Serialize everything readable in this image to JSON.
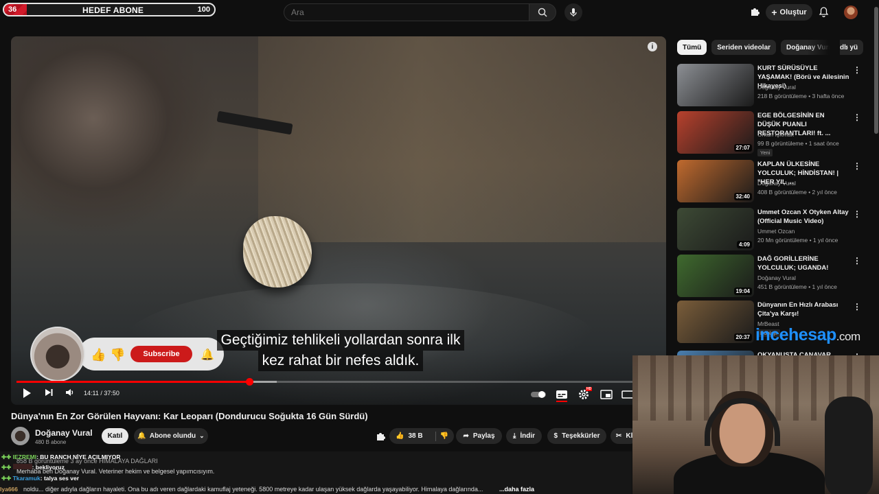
{
  "goal": {
    "current": "36",
    "label": "HEDEF ABONE",
    "target": "100",
    "progress_fraction": 0.36
  },
  "search": {
    "placeholder": "Ara"
  },
  "header": {
    "create_label": "Oluştur",
    "create_icon": "plus-icon",
    "notifications_icon": "bell-icon"
  },
  "player": {
    "captions": [
      "Geçtiğimiz tehlikeli yollardan sonra ilk",
      "kez rahat bir nefes aldık."
    ],
    "time": "14:11 / 37:50",
    "played_fraction": 0.376,
    "buffered_fraction": 0.42,
    "info_label": "i",
    "subscribe_widget_label": "Subscribe",
    "settings_badge": "HD"
  },
  "video": {
    "title": "Dünya'nın En Zor Görülen Hayvanı: Kar Leoparı (Dondurucu Soğukta 16 Gün Sürdü)",
    "channel": "Doğanay Vural",
    "subscribers": "480 B abone",
    "join_label": "Katıl",
    "subscribed_label": "Abone olundu",
    "likes": "38 B",
    "share_label": "Paylaş",
    "download_label": "İndir",
    "thanks_label": "Teşekkürler",
    "clip_label": "Kl"
  },
  "description": {
    "views_line": "858 B görüntüleme  3 ay önce  HİMALAYA DAĞLARI",
    "line1": "Merhaba ben Doğanay Vural. Veteriner hekim ve belgesel yapımcısıyım.",
    "line2": "noldu... diğer adıyla dağların hayaleti. Ona bu adı veren dağlardaki kamuflaj yeteneği. 5800 metreye kadar ulaşan yüksek dağlarda yaşayabiliyor. Himalaya dağlarında...",
    "more_label": "...daha fazla"
  },
  "chat": [
    {
      "user": "IEZREMI",
      "text": ": BU RANCH NİYE AÇILMIYOR",
      "color": "#7bd35a"
    },
    {
      "user": "",
      "text": ": bekliyoruz",
      "color": "#c04646"
    },
    {
      "user": "Tkaramuk",
      "text": ": talya ses ver",
      "color": "#3aa0e0"
    },
    {
      "user": "lya666",
      "text": "",
      "color": "#c9a060"
    }
  ],
  "watermark": {
    "brand": "incehesap",
    "tld": ".com"
  },
  "sidebar": {
    "chips": [
      "Tümü",
      "Seriden videolar",
      "Doğanay Vural adlı yü"
    ],
    "recommendations": [
      {
        "title": "KURT SÜRÜSÜYLE YAŞAMAK! (Börü ve Ailesinin Hikayesi)",
        "channel": "Doğanay Vural",
        "meta": "218 B görüntüleme • 3 hafta önce",
        "duration": "",
        "new": "",
        "thumb_color": "#8c8f94"
      },
      {
        "title": "EGE BÖLGESİNİN EN DÜŞÜK PUANLI RESTORANTLARI! ft. ...",
        "channel": "Orkun Işıtmak",
        "meta": "99 B görüntüleme • 1 saat önce",
        "duration": "27:07",
        "new": "Yeni",
        "thumb_color": "#b8412d"
      },
      {
        "title": "KAPLAN ÜLKESİNE YOLCULUK; HİNDİSTAN! | \"HER YIL ...",
        "channel": "Doğanay Vural",
        "meta": "408 B görüntüleme • 2 yıl önce",
        "duration": "32:40",
        "new": "",
        "thumb_color": "#c06a2e"
      },
      {
        "title": "Ummet Ozcan X Otyken   Altay (Official Music Video)",
        "channel": "Ummet Ozcan",
        "meta": "20 Mn görüntüleme • 1 yıl önce",
        "duration": "4:09",
        "new": "",
        "thumb_color": "#3d4a35"
      },
      {
        "title": "DAĞ GORİLLERİNE YOLCULUK; UGANDA!",
        "channel": "Doğanay Vural",
        "meta": "451 B görüntüleme • 1 yıl önce",
        "duration": "19:04",
        "new": "",
        "thumb_color": "#3f6a2e"
      },
      {
        "title": "Dünyanın En Hızlı Arabası Çita'ya Karşı!",
        "channel": "MrBeast",
        "meta": "",
        "duration": "20:37",
        "new": "Dublajlı",
        "thumb_color": "#7a5d3a"
      },
      {
        "title": "OKYANUSTA CANAVAR",
        "channel": "",
        "meta": "",
        "duration": "",
        "new": "",
        "thumb_color": "#4a7fb0"
      }
    ]
  }
}
